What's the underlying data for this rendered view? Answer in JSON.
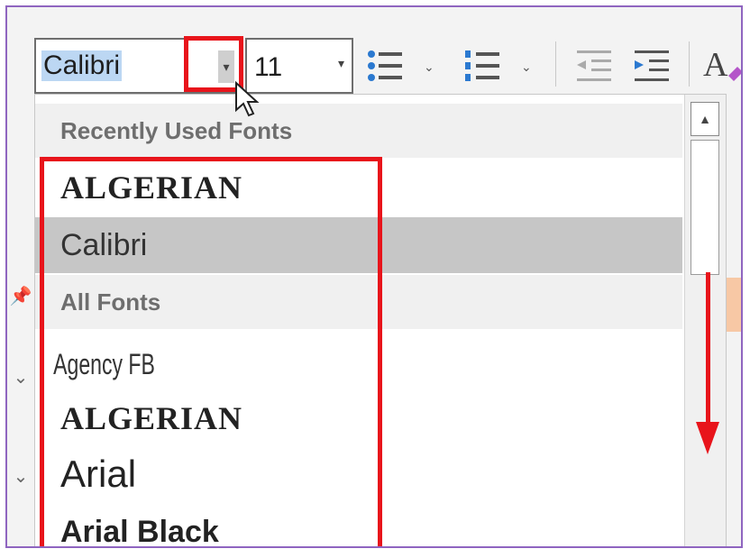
{
  "toolbar": {
    "font_name": "Calibri",
    "font_size": "11",
    "dropdown_glyph": "▾",
    "chevron": "⌄",
    "icons": [
      "bullet-list-icon",
      "numbered-list-icon",
      "decrease-indent-icon",
      "increase-indent-icon",
      "clear-formatting-icon"
    ]
  },
  "dropdown": {
    "recent_header": "Recently Used Fonts",
    "all_header": "All Fonts",
    "recent_fonts": [
      "ALGERIAN",
      "Calibri"
    ],
    "all_fonts": [
      "Agency FB",
      "ALGERIAN",
      "Arial",
      "Arial Black"
    ],
    "selected_font": "Calibri",
    "scroll_up_glyph": "▲"
  },
  "colors": {
    "annotation_red": "#e8141b",
    "frame_purple": "#8f65c0",
    "selection_blue": "#bcd7f3",
    "selected_row": "#c6c6c6"
  }
}
